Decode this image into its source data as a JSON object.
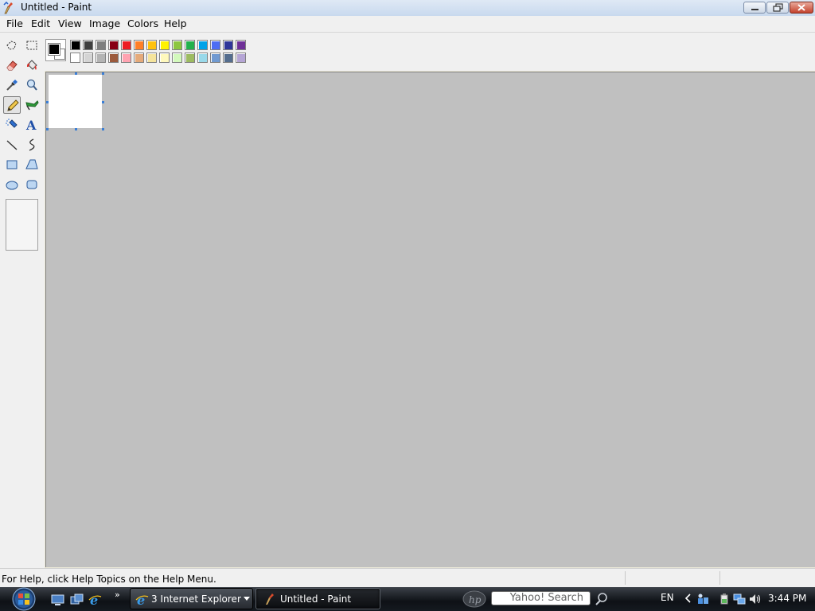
{
  "window": {
    "title": "Untitled - Paint"
  },
  "menu": [
    {
      "label": "File"
    },
    {
      "label": "Edit"
    },
    {
      "label": "View"
    },
    {
      "label": "Image"
    },
    {
      "label": "Colors"
    },
    {
      "label": "Help"
    }
  ],
  "tools": [
    {
      "name": "free-form-select-tool",
      "icon": "free-form-select-icon"
    },
    {
      "name": "select-tool",
      "icon": "rect-select-icon"
    },
    {
      "name": "eraser-tool",
      "icon": "eraser-icon"
    },
    {
      "name": "fill-tool",
      "icon": "paint-bucket-icon"
    },
    {
      "name": "pick-color-tool",
      "icon": "eyedropper-icon"
    },
    {
      "name": "magnifier-tool",
      "icon": "magnifier-icon"
    },
    {
      "name": "pencil-tool",
      "icon": "pencil-icon",
      "selected": true
    },
    {
      "name": "brush-tool",
      "icon": "brush-icon"
    },
    {
      "name": "airbrush-tool",
      "icon": "airbrush-icon"
    },
    {
      "name": "text-tool",
      "icon": "text-icon"
    },
    {
      "name": "line-tool",
      "icon": "line-icon"
    },
    {
      "name": "curve-tool",
      "icon": "curve-icon"
    },
    {
      "name": "rectangle-tool",
      "icon": "rectangle-icon"
    },
    {
      "name": "polygon-tool",
      "icon": "polygon-icon"
    },
    {
      "name": "ellipse-tool",
      "icon": "ellipse-icon"
    },
    {
      "name": "rounded-rectangle-tool",
      "icon": "rounded-rectangle-icon"
    }
  ],
  "colors": {
    "foreground": "#000000",
    "background": "#ffffff",
    "palette_top": [
      "#000000",
      "#3f3f3f",
      "#7f7f7f",
      "#880015",
      "#ed1c24",
      "#ff7f27",
      "#ffc20e",
      "#fff200",
      "#8dc63f",
      "#22b14c",
      "#00a2e8",
      "#4d6df3",
      "#2f3699",
      "#6f3198"
    ],
    "palette_bottom": [
      "#ffffff",
      "#d4d4d4",
      "#b4b4b4",
      "#9c5a3c",
      "#ffa3b1",
      "#e5aa7a",
      "#f5e49c",
      "#fff9bd",
      "#d3f9bc",
      "#9dbb61",
      "#99d9ea",
      "#709ad1",
      "#546d8e",
      "#b5a5d5"
    ]
  },
  "status": {
    "help_text": "For Help, click Help Topics on the Help Menu."
  },
  "taskbar": {
    "ie_label": "3 Internet Explorer",
    "paint_label": "Untitled - Paint",
    "search_placeholder": "Yahoo! Search",
    "language": "EN",
    "clock": "3:44 PM"
  }
}
